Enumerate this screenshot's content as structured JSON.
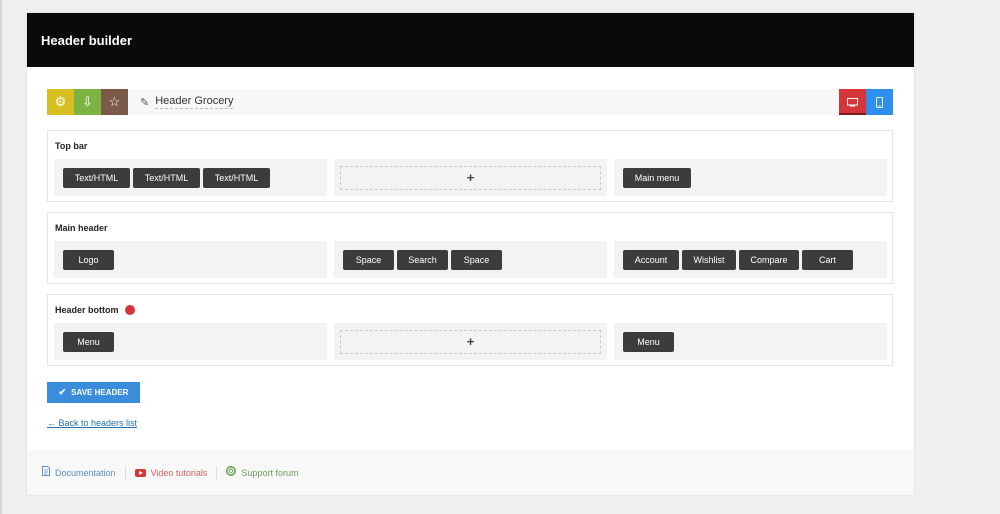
{
  "window": {
    "title": "Header builder"
  },
  "toolbar": {
    "header_name": "Header Grocery",
    "icons": [
      "gear-icon",
      "download-icon",
      "star-icon",
      "pencil-icon"
    ],
    "device_icons": [
      "desktop-icon",
      "mobile-icon"
    ]
  },
  "rows": [
    {
      "title": "Top bar",
      "left": [
        "Text/HTML",
        "Text/HTML",
        "Text/HTML"
      ],
      "center_empty": "+",
      "right": [
        "Main menu"
      ]
    },
    {
      "title": "Main header",
      "left": [
        "Logo"
      ],
      "center": [
        "Space",
        "Search",
        "Space"
      ],
      "right": [
        "Account",
        "Wishlist",
        "Compare",
        "Cart"
      ]
    },
    {
      "title": "Header bottom",
      "left": [
        "Menu"
      ],
      "center_empty": "+",
      "right": [
        "Menu"
      ]
    }
  ],
  "actions": {
    "save_label": "SAVE HEADER",
    "back_label": "← Back to headers list"
  },
  "footer": {
    "documentation": "Documentation",
    "video": "Video tutorials",
    "support": "Support forum"
  },
  "colors": {
    "title_bg": "#0a0a0a",
    "gear": "#d7bf22",
    "download": "#7cb342",
    "star": "#7b5a4a",
    "desktop": "#d63638",
    "mobile": "#2d8ff0",
    "save": "#3a8ddb"
  }
}
